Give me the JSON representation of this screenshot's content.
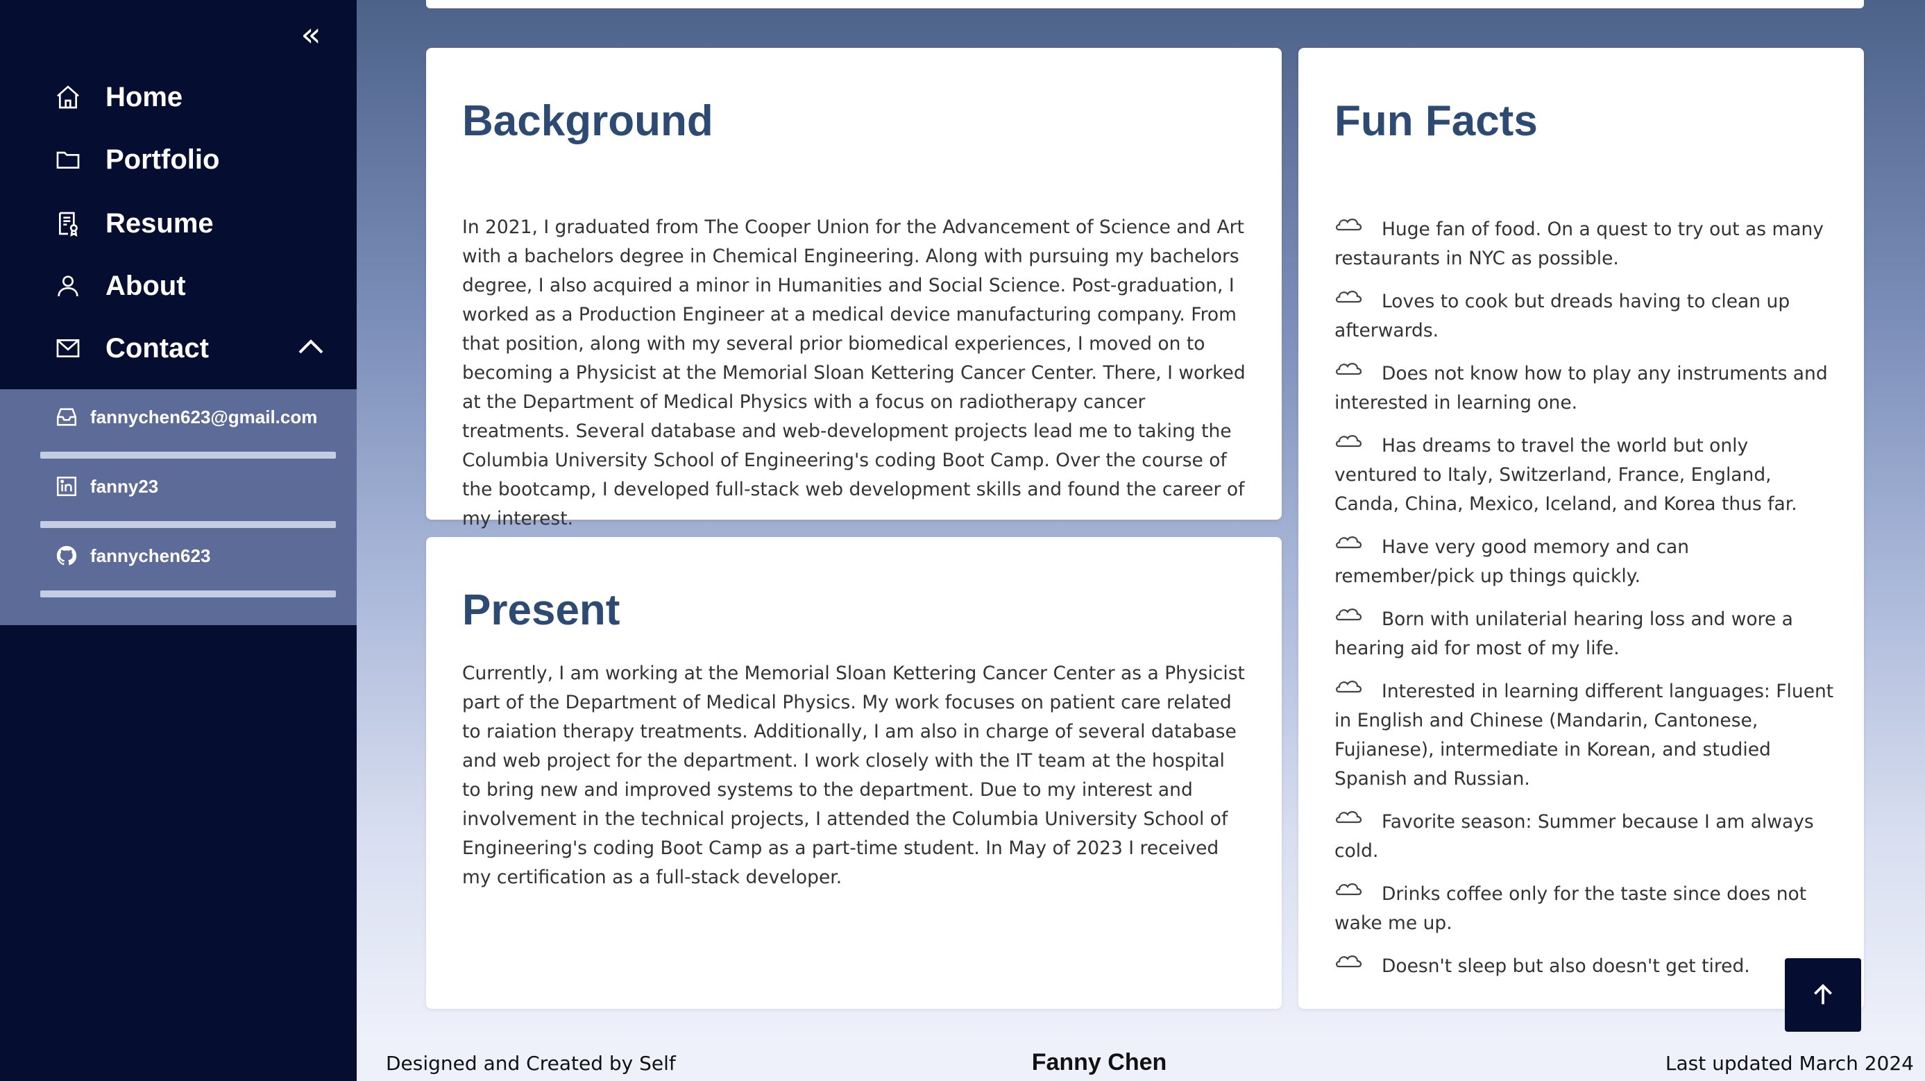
{
  "sidebar": {
    "nav": [
      {
        "label": "Home",
        "icon": "home-icon"
      },
      {
        "label": "Portfolio",
        "icon": "folder-icon"
      },
      {
        "label": "Resume",
        "icon": "resume-icon"
      },
      {
        "label": "About",
        "icon": "user-icon"
      },
      {
        "label": "Contact",
        "icon": "mail-icon"
      }
    ],
    "contacts": [
      {
        "label": "fannychen623@gmail.com",
        "icon": "inbox-icon"
      },
      {
        "label": "fanny23",
        "icon": "linkedin-icon"
      },
      {
        "label": "fannychen623",
        "icon": "github-icon"
      }
    ]
  },
  "background": {
    "title": "Background",
    "text": "In 2021, I graduated from The Cooper Union for the Advancement of Science and Art with a bachelors degree in Chemical Engineering. Along with pursuing my bachelors degree, I also acquired a minor in Humanities and Social Science. Post-graduation, I worked as a Production Engineer at a medical device manufacturing company. From that position, along with my several prior biomedical experiences, I moved on to becoming a Physicist at the Memorial Sloan Kettering Cancer Center. There, I worked at the Department of Medical Physics with a focus on radiotherapy cancer treatments. Several database and web-development projects lead me to taking the Columbia University School of Engineering's coding Boot Camp. Over the course of the bootcamp, I developed full-stack web development skills and found the career of my interest."
  },
  "present": {
    "title": "Present",
    "text": "Currently, I am working at the Memorial Sloan Kettering Cancer Center as a Physicist part of the Department of Medical Physics. My work focuses on patient care related to raiation therapy treatments. Additionally, I am also in charge of several database and web project for the department. I work closely with the IT team at the hospital to bring new and improved systems to the department. Due to my interest and involvement in the technical projects, I attended the Columbia University School of Engineering's coding Boot Camp as a part-time student. In May of 2023 I received my certification as a full-stack developer."
  },
  "fun_facts": {
    "title": "Fun Facts",
    "items": [
      "Huge fan of food. On a quest to try out as many restaurants in NYC as possible.",
      "Loves to cook but dreads having to clean up afterwards.",
      "Does not know how to play any instruments and interested in learning one.",
      "Has dreams to travel the world but only ventured to Italy, Switzerland, France, England, Canda, China, Mexico, Iceland, and Korea thus far.",
      "Have very good memory and can remember/pick up things quickly.",
      "Born with unilaterial hearing loss and wore a hearing aid for most of my life.",
      "Interested in learning different languages: Fluent in English and Chinese (Mandarin, Cantonese, Fujianese), intermediate in Korean, and studied Spanish and Russian.",
      "Favorite season: Summer because I am always cold.",
      "Drinks coffee only for the taste since does not wake me up.",
      "Doesn't sleep but also doesn't get tired."
    ]
  },
  "footer": {
    "left": "Designed and Created by Self",
    "center": "Fanny Chen",
    "right": "Last updated March 2024"
  },
  "colors": {
    "sidebar_bg": "#050e30",
    "contact_panel_bg": "#5c6b97",
    "heading": "#2d4a73"
  }
}
